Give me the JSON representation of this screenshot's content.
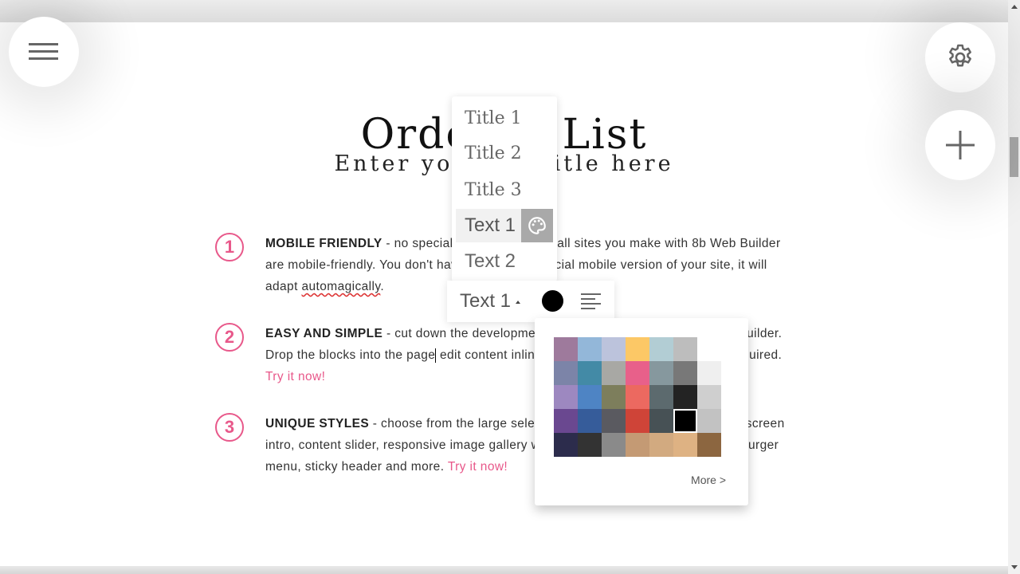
{
  "page": {
    "title": "Ordered List",
    "subtitle": "Enter your subtitle here"
  },
  "list": {
    "items": [
      {
        "number": "1",
        "heading": "MOBILE FRIENDLY",
        "text_before": " - no special actions required, all sites you make with 8b Web Builder are mobile-friendly. You don't have to create a special mobile version of your site, it will adapt ",
        "squiggle_word": "automagically",
        "text_after": ".",
        "link": ""
      },
      {
        "number": "2",
        "heading": "EASY AND SIMPLE",
        "text_before": " - cut down the development time with drag-and-drop website builder. Drop the blocks into the page",
        "text_after": " edit content inline and publish - no technical skills required. ",
        "link": "Try it now!"
      },
      {
        "number": "3",
        "heading": "UNIQUE STYLES",
        "text_before": " - choose from the large selection of latest pre-made blocks - full-screen intro, content slider, responsive image gallery with lightbox, parallax scrolling, hamburger menu, sticky header and more. ",
        "link": "Try it now!"
      }
    ]
  },
  "fabs": {
    "menu_icon": "hamburger-icon",
    "settings_icon": "gear-icon",
    "add_icon": "plus-icon"
  },
  "style_menu": {
    "items": [
      {
        "label": "Title 1",
        "kind": "serif"
      },
      {
        "label": "Title 2",
        "kind": "serif"
      },
      {
        "label": "Title 3",
        "kind": "serif"
      },
      {
        "label": "Text 1",
        "kind": "sans",
        "active": true
      },
      {
        "label": "Text 2",
        "kind": "sans"
      }
    ],
    "palette_icon": "palette-icon"
  },
  "text_toolbar": {
    "style_label": "Text 1",
    "current_color": "#000000",
    "align_icon": "align-left-icon"
  },
  "color_popup": {
    "swatches": [
      "#9e7a9c",
      "#93b7d9",
      "#bcc3dc",
      "#fcc866",
      "#b2cdd4",
      "#bdbdbd",
      "#ffffff",
      "#7c84a8",
      "#438aa6",
      "#a8a8a4",
      "#e8608a",
      "#86989e",
      "#787878",
      "#efefef",
      "#9d88c0",
      "#4e84c4",
      "#7d7e5c",
      "#ec6960",
      "#5c6a6e",
      "#232323",
      "#cfcfcf",
      "#6a4890",
      "#365c9a",
      "#5a5a60",
      "#cf4438",
      "#475155",
      "#000000",
      "#c2c2c2",
      "#2c2c4c",
      "#333333",
      "#8a8a8a",
      "#c49a74",
      "#d2aa80",
      "#deb283",
      "#8c6640"
    ],
    "selected_index": 26,
    "more_label": "More >"
  },
  "colors": {
    "accent": "#e8588a",
    "text": "#333333"
  }
}
